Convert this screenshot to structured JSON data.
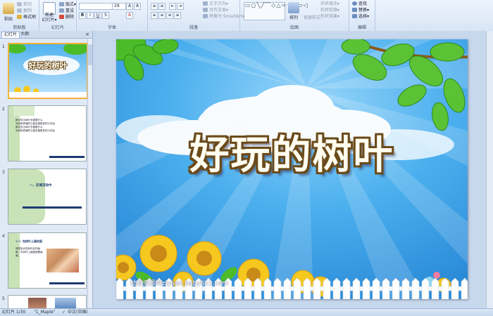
{
  "ribbon": {
    "clipboard": {
      "label": "剪贴板",
      "paste": "粘贴",
      "cut": "剪切",
      "copy": "复制",
      "format_painter": "格式刷"
    },
    "slides": {
      "label": "幻灯片",
      "new_slide": "新建",
      "new_slide2": "幻灯片▾",
      "layout": "版式▾",
      "reset": "重设",
      "delete": "删除"
    },
    "font": {
      "label": "字体",
      "font_size": "28"
    },
    "paragraph": {
      "label": "段落",
      "text_direction": "文字方向▾",
      "align_text": "对齐文本▾",
      "convert_smartart": "转换为 SmartArt▾"
    },
    "drawing": {
      "label": "绘图",
      "arrange": "排列",
      "quick_styles": "快速样式",
      "shape_fill": "形状填充▾",
      "shape_outline": "形状轮廓▾",
      "shape_effects": "形状效果▾"
    },
    "editing": {
      "label": "编辑",
      "find": "查找",
      "replace": "替换▾",
      "select": "选择▾"
    }
  },
  "left_pane": {
    "tabs": [
      "幻灯片",
      "大纲"
    ],
    "close": "×",
    "slides": [
      {
        "num": "1",
        "title": "好玩的树叶"
      },
      {
        "num": "2",
        "bullets": [
          "雨中的小树叶去做更什么",
          "为妈妈表演的小朋友做更多的小花朵",
          "雨中的小树叶去做更什么",
          "为妈妈表演的小朋友做更多的小花朵"
        ]
      },
      {
        "num": "3",
        "text": "一、区域活动中"
      },
      {
        "num": "4",
        "title": "（一）在树叶上画的面",
        "bullet": "请送到大的树叶后作画面，在树叶上画面观看画面。"
      },
      {
        "num": "5"
      }
    ]
  },
  "slide": {
    "title": "好玩的树叶",
    "watermark": "幼教资源网ziyuan.baby611.com",
    "watermark_sub": "PPT课件 · FLASH课件 · 教案 · 试卷"
  },
  "status": {
    "slide_indicator": "幻灯片 1/30",
    "theme": "\"1_Maple\"",
    "language": "中文(中国)"
  },
  "colors": {
    "sky": "#3f9ee0",
    "leaf": "#4cbb2a",
    "sunflower": "#f6c81f",
    "title_outline": "#6b4a1a",
    "thumb_green": "#c9e2b8",
    "thumb_navy": "#1f3a73"
  }
}
